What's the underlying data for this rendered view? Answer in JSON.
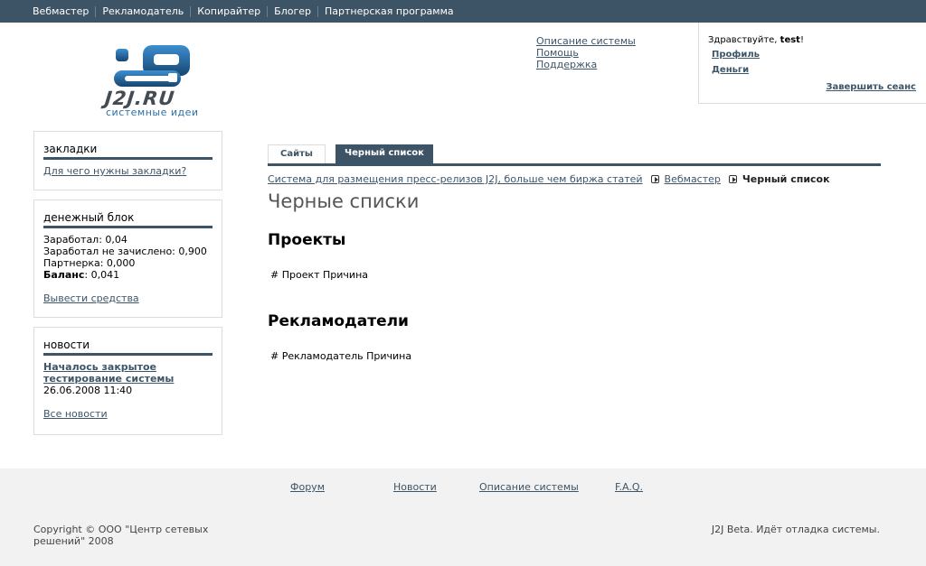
{
  "topnav": [
    "Вебмастер",
    "Рекламодатель",
    "Копирайтер",
    "Блогер",
    "Партнерская программа"
  ],
  "logo": {
    "brand": "J2J.RU",
    "tagline": "системные идеи"
  },
  "header_links": [
    "Описание системы",
    "Помощь",
    "Поддержка"
  ],
  "user": {
    "greeting": "Здравствуйте, ",
    "name": "test",
    "greeting_end": "!",
    "profile": "Профиль",
    "money": "Деньги",
    "logout": "Завершить сеанс"
  },
  "panels": {
    "bookmarks": {
      "title": "закладки",
      "link": "Для чего нужны закладки?"
    },
    "money": {
      "title": "денежный блок",
      "earned": "Заработал: 0,04",
      "not_credited": "Заработал не зачислено: 0,900",
      "partner": "Партнерка: 0,000",
      "balance_label": "Баланс",
      "balance_value": ": 0,041",
      "withdraw": "Вывести средства"
    },
    "news": {
      "title": "новости",
      "item_title": "Началось закрытое тестирование системы",
      "item_date": "26.06.2008 11:40",
      "all": "Все новости"
    }
  },
  "tabs": {
    "sites": "Сайты",
    "blacklist": "Черный список"
  },
  "breadcrumb": {
    "root": "Система для размещения пресс-релизов J2J, больше чем биржа статей",
    "webmaster": "Вебмастер",
    "current": "Черный список"
  },
  "page_title": "Черные списки",
  "projects": {
    "heading": "Проекты",
    "header_row": "# Проект Причина"
  },
  "advertisers": {
    "heading": "Рекламодатели",
    "header_row": "# Рекламодатель Причина"
  },
  "footer": {
    "links": [
      "Форум",
      "Новости",
      "Описание системы",
      "F.A.Q."
    ],
    "copyright": "Copyright © ООО \"Центр сетевых решений\" 2008",
    "beta": "J2J Beta. Идёт отладка системы."
  },
  "colors": {
    "accent": "#3d5466",
    "link": "#3d5568",
    "logo_blue": "#2d6fa6"
  }
}
